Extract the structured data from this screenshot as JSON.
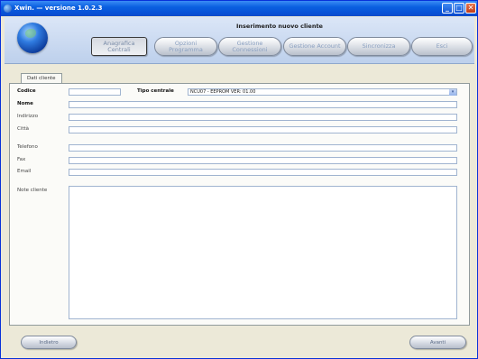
{
  "window": {
    "title": "Xwin. — versione 1.0.2.3",
    "minimize_glyph": "_",
    "maximize_glyph": "□",
    "close_glyph": "✕"
  },
  "header": {
    "title": "Inserimento nuovo cliente",
    "logo_icon": "globe-icon",
    "nav": [
      {
        "line1": "Anagrafica",
        "line2": "Centrali"
      },
      {
        "line1": "Opzioni",
        "line2": "Programma"
      },
      {
        "line1": "Gestione",
        "line2": "Connessioni"
      },
      {
        "line1": "Gestione Account",
        "line2": ""
      },
      {
        "line1": "Sincronizza",
        "line2": ""
      },
      {
        "line1": "Esci",
        "line2": ""
      }
    ]
  },
  "form": {
    "tab_label": "Dati cliente",
    "codice_label": "Codice",
    "codice_value": "",
    "tipo_centrale_label": "Tipo centrale",
    "tipo_centrale_value": "NCU07 - EEPROM VER: 01.00",
    "nome_label": "Nome",
    "indirizzo_label": "Indirizzo",
    "citta_label": "Città",
    "telefono_label": "Telefono",
    "fax_label": "Fax",
    "email_label": "Email",
    "note_label": "Note cliente"
  },
  "footer": {
    "back_label": "Indietro",
    "next_label": "Avanti"
  },
  "colors": {
    "titlebar": "#0a5fe0",
    "window_bg": "#ece9d8",
    "header_bg": "#bdd0ec",
    "field_border": "#a0b4d0"
  }
}
